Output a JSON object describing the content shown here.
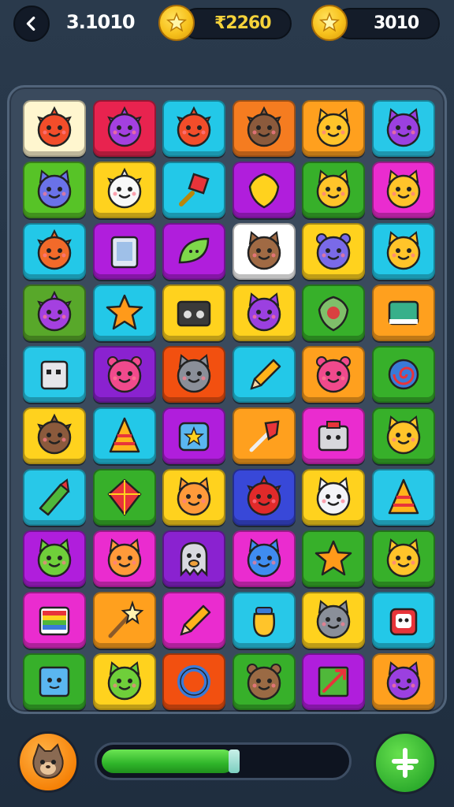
{
  "header": {
    "back_icon": "back-arrow-icon",
    "score": "3.1010",
    "currency_1": {
      "icon": "star-coin-icon",
      "value": "₹2260",
      "color": "#f5d23a"
    },
    "currency_2": {
      "icon": "star-coin-icon",
      "value": "3010",
      "color": "#ffffff"
    }
  },
  "board": {
    "columns": 6,
    "rows": 10,
    "tiles": [
      {
        "bg": "#fff6cf",
        "icon": "sun-face"
      },
      {
        "bg": "#e8234f",
        "icon": "purple-critter"
      },
      {
        "bg": "#23c8e8",
        "icon": "sun-face"
      },
      {
        "bg": "#f57c20",
        "icon": "brown-critter"
      },
      {
        "bg": "#ffa01e",
        "icon": "cat-face"
      },
      {
        "bg": "#28c8e8",
        "icon": "purple-cat"
      },
      {
        "bg": "#57c327",
        "icon": "blue-cat"
      },
      {
        "bg": "#ffd21e",
        "icon": "white-chicken"
      },
      {
        "bg": "#23c8e8",
        "icon": "red-gem-sword"
      },
      {
        "bg": "#b01edc",
        "icon": "yellow-shield"
      },
      {
        "bg": "#37b02a",
        "icon": "cat-face"
      },
      {
        "bg": "#ea2ccf",
        "icon": "cat-face"
      },
      {
        "bg": "#23c8e8",
        "icon": "orange-critter"
      },
      {
        "bg": "#b01edc",
        "icon": "blue-book"
      },
      {
        "bg": "#b01edc",
        "icon": "green-leaf"
      },
      {
        "bg": "#ffffff",
        "icon": "brown-cat"
      },
      {
        "bg": "#ffd21e",
        "icon": "purple-bear"
      },
      {
        "bg": "#23c8e8",
        "icon": "cat-face"
      },
      {
        "bg": "#58a82a",
        "icon": "purple-critter"
      },
      {
        "bg": "#23c8e8",
        "icon": "orange-star"
      },
      {
        "bg": "#ffd21e",
        "icon": "cassette"
      },
      {
        "bg": "#ffd21e",
        "icon": "purple-cat"
      },
      {
        "bg": "#37b02a",
        "icon": "green-shield"
      },
      {
        "bg": "#ffa01e",
        "icon": "green-book"
      },
      {
        "bg": "#28c8e8",
        "icon": "robot-box"
      },
      {
        "bg": "#8a22d0",
        "icon": "pink-bear"
      },
      {
        "bg": "#f25010",
        "icon": "gray-cat"
      },
      {
        "bg": "#23c8e8",
        "icon": "pencil"
      },
      {
        "bg": "#ffa01e",
        "icon": "pink-bear"
      },
      {
        "bg": "#37b02a",
        "icon": "spiral-shell"
      },
      {
        "bg": "#ffd21e",
        "icon": "brown-critter"
      },
      {
        "bg": "#23c8e8",
        "icon": "party-hat"
      },
      {
        "bg": "#b01edc",
        "icon": "blue-star-card"
      },
      {
        "bg": "#ffa01e",
        "icon": "red-sword"
      },
      {
        "bg": "#ea2ccf",
        "icon": "toaster-box"
      },
      {
        "bg": "#37b02a",
        "icon": "cat-face"
      },
      {
        "bg": "#28c8e8",
        "icon": "green-crayon"
      },
      {
        "bg": "#37b02a",
        "icon": "kite"
      },
      {
        "bg": "#ffd21e",
        "icon": "orange-cat"
      },
      {
        "bg": "#3848d8",
        "icon": "red-critter"
      },
      {
        "bg": "#ffd21e",
        "icon": "white-cat"
      },
      {
        "bg": "#28c8e8",
        "icon": "party-hat"
      },
      {
        "bg": "#b01edc",
        "icon": "green-critter"
      },
      {
        "bg": "#ea2ccf",
        "icon": "orange-cat"
      },
      {
        "bg": "#8a22d0",
        "icon": "ghost"
      },
      {
        "bg": "#ea2ccf",
        "icon": "blue-critter"
      },
      {
        "bg": "#37b02a",
        "icon": "orange-star"
      },
      {
        "bg": "#37b02a",
        "icon": "cat-face"
      },
      {
        "bg": "#ea2ccf",
        "icon": "rainbow-box"
      },
      {
        "bg": "#ffa01e",
        "icon": "magic-wand"
      },
      {
        "bg": "#ea2ccf",
        "icon": "pencil"
      },
      {
        "bg": "#28c8e8",
        "icon": "honey-pot"
      },
      {
        "bg": "#ffd21e",
        "icon": "gray-cat"
      },
      {
        "bg": "#23c8e8",
        "icon": "red-robot"
      },
      {
        "bg": "#37b02a",
        "icon": "blue-box"
      },
      {
        "bg": "#ffd21e",
        "icon": "green-critter"
      },
      {
        "bg": "#f25010",
        "icon": "blue-ring"
      },
      {
        "bg": "#37b02a",
        "icon": "brown-bear"
      },
      {
        "bg": "#b01edc",
        "icon": "green-arrow-box"
      },
      {
        "bg": "#ffa01e",
        "icon": "purple-cat"
      }
    ]
  },
  "footer": {
    "avatar_icon": "cat-avatar-icon",
    "progress": 0.55,
    "add_icon": "plus-icon"
  }
}
